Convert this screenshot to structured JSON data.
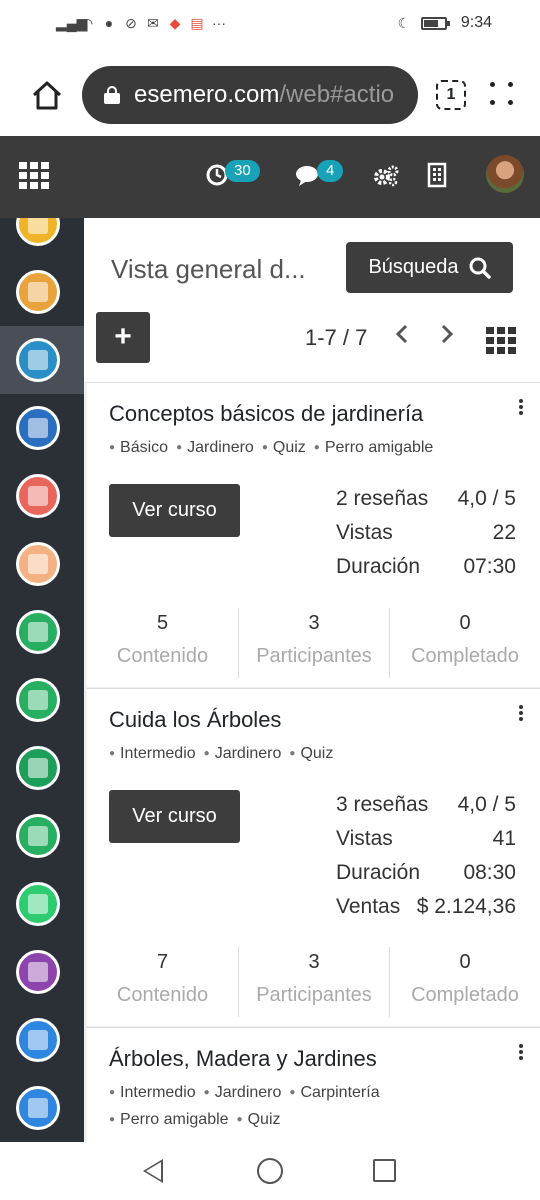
{
  "status_bar": {
    "time": "9:34",
    "icons": [
      "signal-icon",
      "wifi-icon",
      "chat-icon",
      "blocked-icon",
      "mail-icon",
      "location-icon",
      "calendar-icon",
      "more-icon",
      "moon-icon",
      "battery-icon"
    ],
    "more": "···"
  },
  "browser": {
    "url_host": "esemero.com",
    "url_path": "/web#actio",
    "tab_count": "1"
  },
  "navbar": {
    "activity_count": "30",
    "messages_count": "4"
  },
  "sidebar": {
    "items": [
      {
        "icon": "notebook-icon",
        "color": "#f0b429"
      },
      {
        "icon": "transport-icon",
        "color": "#e8a33d"
      },
      {
        "icon": "elearning-icon",
        "color": "#2a8fc6",
        "active": true
      },
      {
        "icon": "meeting-icon",
        "color": "#2a6fbf"
      },
      {
        "icon": "money-icon",
        "color": "#e8665b"
      },
      {
        "icon": "inventory-icon",
        "color": "#f4b183"
      },
      {
        "icon": "funnel-icon",
        "color": "#27ae60"
      },
      {
        "icon": "payroll-icon",
        "color": "#27ae60"
      },
      {
        "icon": "pos-icon",
        "color": "#1e9e5b"
      },
      {
        "icon": "support-icon",
        "color": "#27ae60"
      },
      {
        "icon": "delivery-icon",
        "color": "#2ecc71"
      },
      {
        "icon": "website-icon",
        "color": "#8e44ad"
      },
      {
        "icon": "helpdesk-icon",
        "color": "#2e86de"
      },
      {
        "icon": "checklist-icon",
        "color": "#2e86de"
      }
    ]
  },
  "control": {
    "title": "Vista general d...",
    "search_label": "Búsqueda",
    "create_label": "+",
    "pager": "1-7 / 7"
  },
  "cards": [
    {
      "title": "Conceptos básicos de jardinería",
      "tags": [
        "Básico",
        "Jardinero",
        "Quiz",
        "Perro amigable"
      ],
      "button": "Ver curso",
      "stats": [
        {
          "label": "2 reseñas",
          "value": "4,0 / 5"
        },
        {
          "label": "Vistas",
          "value": "22"
        },
        {
          "label": "Duración",
          "value": "07:30"
        }
      ],
      "counters": [
        {
          "num": "5",
          "label": "Contenido"
        },
        {
          "num": "3",
          "label": "Participantes"
        },
        {
          "num": "0",
          "label": "Completado"
        }
      ]
    },
    {
      "title": "Cuida los Árboles",
      "tags": [
        "Intermedio",
        "Jardinero",
        "Quiz"
      ],
      "button": "Ver curso",
      "stats": [
        {
          "label": "3 reseñas",
          "value": "4,0 / 5"
        },
        {
          "label": "Vistas",
          "value": "41"
        },
        {
          "label": "Duración",
          "value": "08:30"
        },
        {
          "label": "Ventas",
          "value": "$ 2.124,36"
        }
      ],
      "counters": [
        {
          "num": "7",
          "label": "Contenido"
        },
        {
          "num": "3",
          "label": "Participantes"
        },
        {
          "num": "0",
          "label": "Completado"
        }
      ]
    },
    {
      "title": "Árboles, Madera y Jardines",
      "tags": [
        "Intermedio",
        "Jardinero",
        "Carpintería"
      ],
      "tags2": [
        "Perro amigable",
        "Quiz"
      ]
    }
  ]
}
